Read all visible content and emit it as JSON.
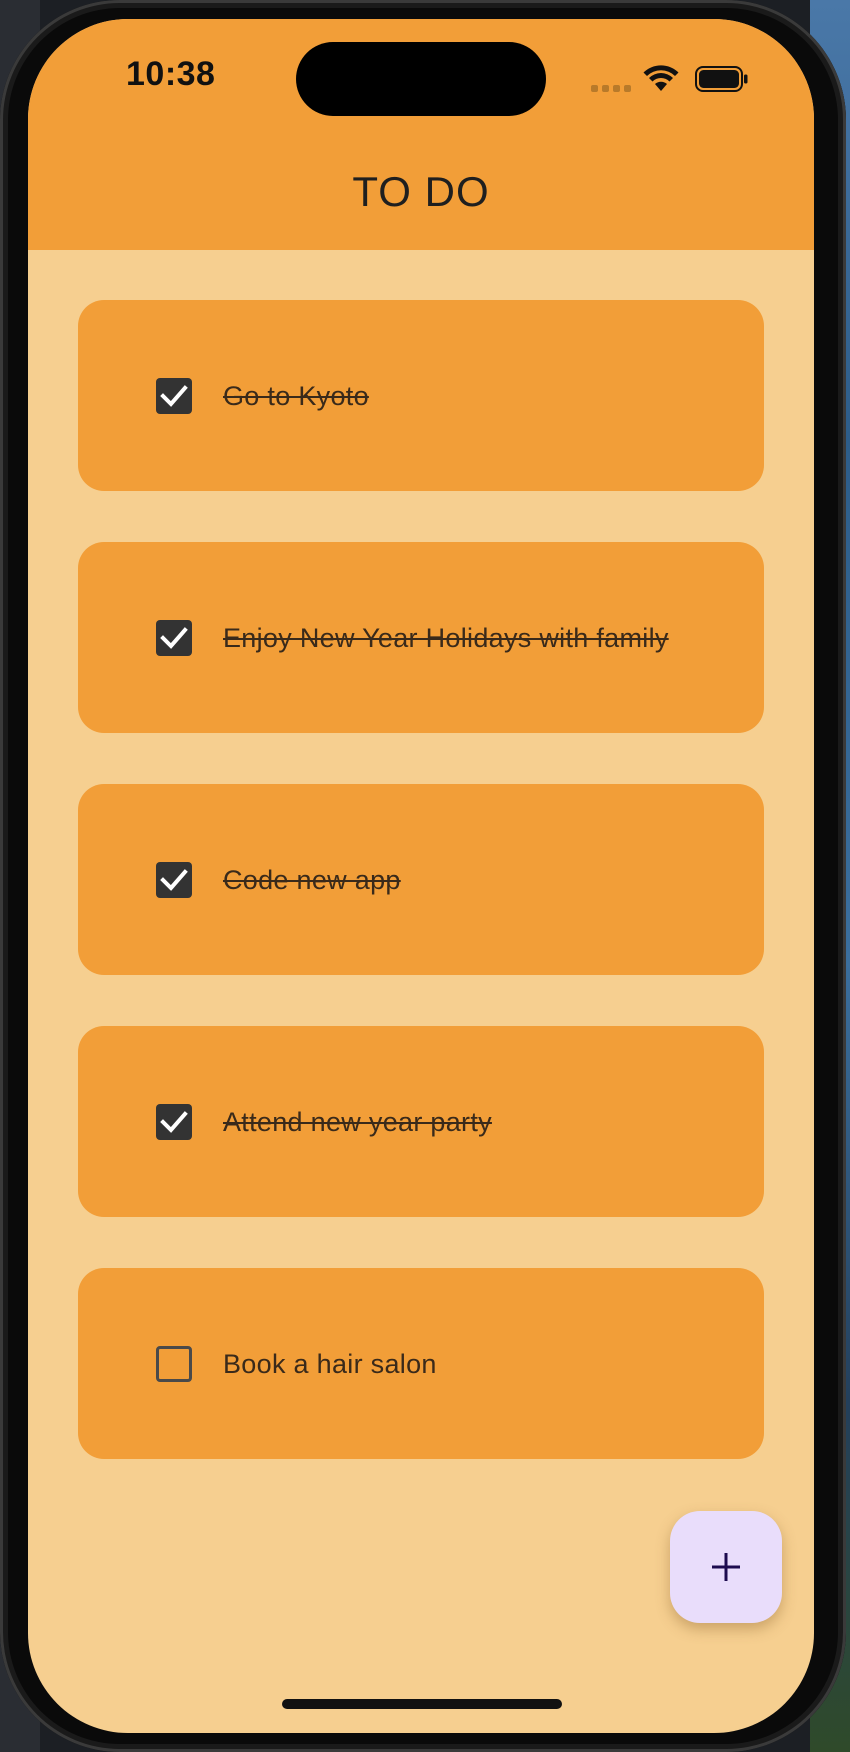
{
  "status_bar": {
    "time": "10:38"
  },
  "app_bar": {
    "title": "TO DO"
  },
  "tasks": [
    {
      "label": "Go to Kyoto",
      "completed": true
    },
    {
      "label": "Enjoy New Year Holidays with family",
      "completed": true
    },
    {
      "label": "Code new app",
      "completed": true
    },
    {
      "label": "Attend new year party",
      "completed": true
    },
    {
      "label": "Book a hair salon",
      "completed": false
    }
  ],
  "fab": {
    "icon": "plus-icon"
  },
  "colors": {
    "app_bar": "#f29e38",
    "background": "#f6cf90",
    "card": "#f29e38",
    "fab": "#e9ddfb",
    "fab_icon": "#1d0b4f"
  }
}
